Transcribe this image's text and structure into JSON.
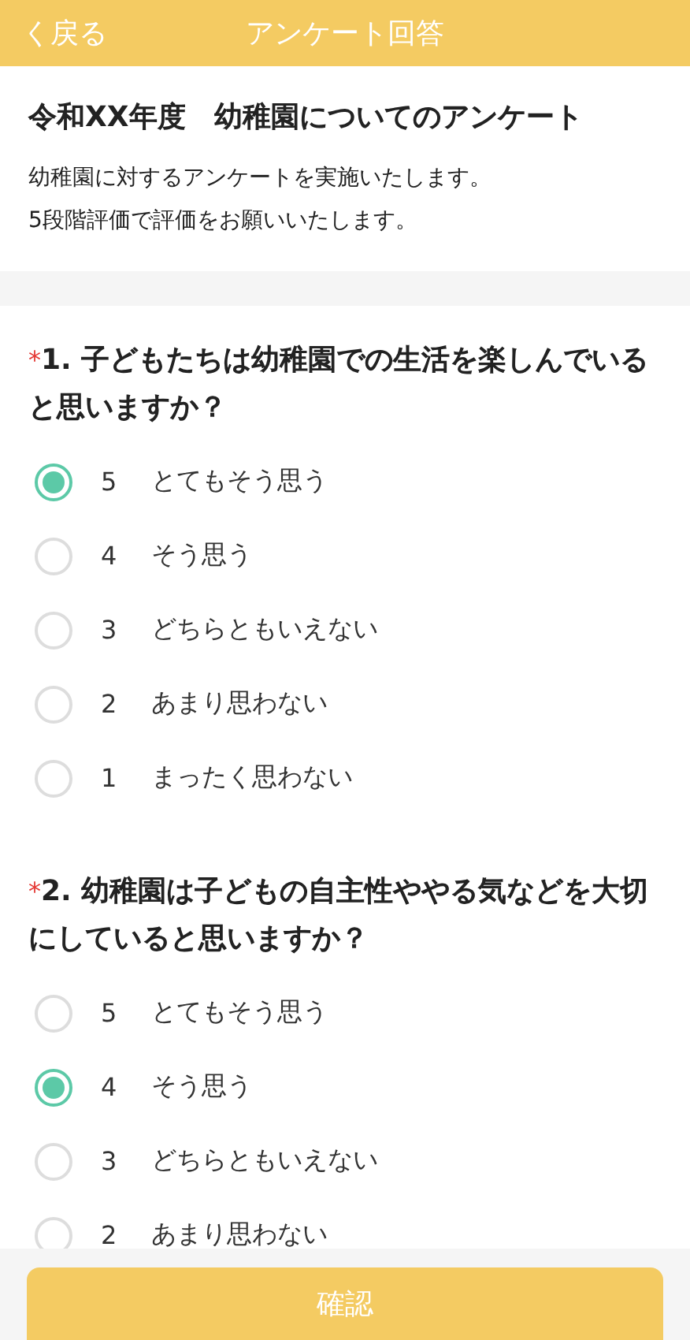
{
  "header": {
    "back": "く戻る",
    "title": "アンケート回答"
  },
  "intro": {
    "title": "令和XX年度　幼稚園についてのアンケート",
    "lines": [
      "幼稚園に対するアンケートを実施いたします。",
      "5段階評価で評価をお願いいたします。"
    ]
  },
  "questions": [
    {
      "required_mark": "*",
      "title": "1. 子どもたちは幼稚園での生活を楽しんでいると思いますか？",
      "options": [
        {
          "value": "5",
          "label": "とてもそう思う",
          "selected": true
        },
        {
          "value": "4",
          "label": "そう思う",
          "selected": false
        },
        {
          "value": "3",
          "label": "どちらともいえない",
          "selected": false
        },
        {
          "value": "2",
          "label": "あまり思わない",
          "selected": false
        },
        {
          "value": "1",
          "label": "まったく思わない",
          "selected": false
        }
      ]
    },
    {
      "required_mark": "*",
      "title": "2. 幼稚園は子どもの自主性ややる気などを大切にしていると思いますか？",
      "options": [
        {
          "value": "5",
          "label": "とてもそう思う",
          "selected": false
        },
        {
          "value": "4",
          "label": "そう思う",
          "selected": true
        },
        {
          "value": "3",
          "label": "どちらともいえない",
          "selected": false
        },
        {
          "value": "2",
          "label": "あまり思わない",
          "selected": false
        }
      ]
    }
  ],
  "confirm_button": "確認"
}
